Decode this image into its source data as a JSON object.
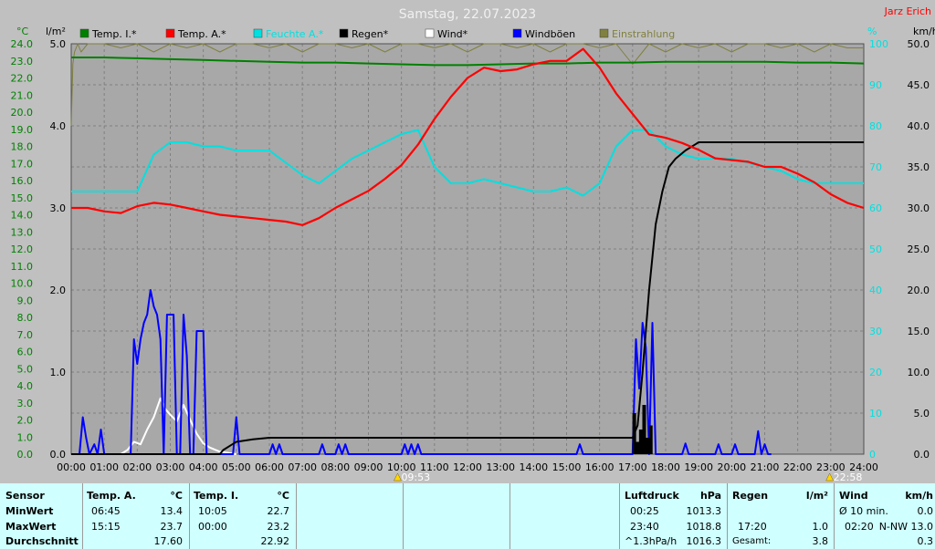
{
  "title": "Samstag, 22.07.2023",
  "station": "Jarz Erich",
  "units": {
    "left1": "°C",
    "left2": "l/m²",
    "right1": "%",
    "right2": "km/h"
  },
  "legend": [
    {
      "label": "Temp. I.*",
      "color": "#008000"
    },
    {
      "label": "Temp. A.*",
      "color": "#ff0000"
    },
    {
      "label": "Feuchte A.*",
      "color": "#00e0e0"
    },
    {
      "label": "Regen*",
      "color": "#000000"
    },
    {
      "label": "Wind*",
      "color": "#ffffff"
    },
    {
      "label": "Windböen",
      "color": "#0000ff"
    },
    {
      "label": "Einstrahlung",
      "color": "#808040"
    }
  ],
  "markers": {
    "sunrise": "09:53",
    "sunset": "22:58"
  },
  "table": {
    "row_labels": {
      "sensor": "Sensor",
      "min": "MinWert",
      "max": "MaxWert",
      "avg": "Durchschnitt"
    },
    "temp_a": {
      "head": "Temp. A.",
      "unit": "°C",
      "min_time": "06:45",
      "min": "13.4",
      "max_time": "15:15",
      "max": "23.7",
      "avg": "17.60"
    },
    "temp_i": {
      "head": "Temp. I.",
      "unit": "°C",
      "min_time": "10:05",
      "min": "22.7",
      "max_time": "00:00",
      "max": "23.2",
      "avg": "22.92"
    },
    "pressure": {
      "head": "Luftdruck",
      "unit": "hPa",
      "min_time": "00:25",
      "min": "1013.3",
      "max_time": "23:40",
      "max": "1018.8",
      "trend": "^1.3hPa/h",
      "avg": "1016.3"
    },
    "rain": {
      "head": "Regen",
      "unit": "l/m²",
      "min_time": "",
      "min": "",
      "max_time": "17:20",
      "max": "1.0",
      "total_label": "Gesamt:",
      "total": "3.8"
    },
    "wind": {
      "head": "Wind",
      "unit": "km/h",
      "min_time": "Ø 10 min.",
      "min": "0.0",
      "max_time": "02:20",
      "max": "N-NW 13.0",
      "avg": "0.3"
    }
  },
  "chart_data": {
    "type": "line",
    "title": "Samstag, 22.07.2023",
    "x_ticks": [
      "00:00",
      "01:00",
      "02:00",
      "03:00",
      "04:00",
      "05:00",
      "06:00",
      "07:00",
      "08:00",
      "09:00",
      "10:00",
      "11:00",
      "12:00",
      "13:00",
      "14:00",
      "15:00",
      "16:00",
      "17:00",
      "18:00",
      "19:00",
      "20:00",
      "21:00",
      "22:00",
      "23:00",
      "24:00"
    ],
    "y_left_temp": {
      "unit": "°C",
      "range": [
        0,
        24
      ],
      "ticks": [
        "0.0",
        "1.0",
        "2.0",
        "3.0",
        "4.0",
        "5.0",
        "6.0",
        "7.0",
        "8.0",
        "9.0",
        "10.0",
        "11.0",
        "12.0",
        "13.0",
        "14.0",
        "15.0",
        "16.0",
        "17.0",
        "18.0",
        "19.0",
        "20.0",
        "21.0",
        "22.0",
        "23.0",
        "24.0"
      ]
    },
    "y_left_rain": {
      "unit": "l/m²",
      "range": [
        0,
        5
      ],
      "ticks": [
        "0.0",
        "1.0",
        "2.0",
        "3.0",
        "4.0",
        "5.0"
      ]
    },
    "y_right_humidity": {
      "unit": "%",
      "range": [
        0,
        100
      ],
      "ticks": [
        "0",
        "10",
        "20",
        "30",
        "40",
        "50",
        "60",
        "70",
        "80",
        "90",
        "100"
      ]
    },
    "y_right_wind": {
      "unit": "km/h",
      "range": [
        0,
        50
      ],
      "ticks": [
        "0.0",
        "5.0",
        "10.0",
        "15.0",
        "20.0",
        "25.0",
        "30.0",
        "35.0",
        "40.0",
        "45.0",
        "50.0"
      ]
    },
    "grid": true,
    "series": [
      {
        "name": "Temp. I.*",
        "axis": "temp",
        "color": "#008000",
        "x": [
          0,
          1,
          2,
          3,
          4,
          5,
          6,
          7,
          8,
          9,
          10,
          11,
          12,
          13,
          14,
          15,
          16,
          17,
          18,
          19,
          20,
          21,
          22,
          23,
          24
        ],
        "y": [
          23.2,
          23.2,
          23.15,
          23.1,
          23.05,
          23.0,
          22.95,
          22.9,
          22.9,
          22.85,
          22.8,
          22.75,
          22.75,
          22.8,
          22.85,
          22.85,
          22.9,
          22.9,
          22.95,
          22.95,
          22.95,
          22.95,
          22.9,
          22.9,
          22.85
        ]
      },
      {
        "name": "Temp. A.*",
        "axis": "temp",
        "color": "#ff0000",
        "x": [
          0,
          0.5,
          1,
          1.5,
          2,
          2.5,
          3,
          3.5,
          4,
          4.5,
          5,
          5.5,
          6,
          6.5,
          7,
          7.5,
          8,
          8.5,
          9,
          9.5,
          10,
          10.5,
          11,
          11.5,
          12,
          12.5,
          13,
          13.5,
          14,
          14.5,
          15,
          15.5,
          16,
          16.5,
          17,
          17.5,
          18,
          18.5,
          19,
          19.5,
          20,
          20.5,
          21,
          21.5,
          22,
          22.5,
          23,
          23.5,
          24
        ],
        "y": [
          14.4,
          14.4,
          14.2,
          14.1,
          14.5,
          14.7,
          14.6,
          14.4,
          14.2,
          14.0,
          13.9,
          13.8,
          13.7,
          13.6,
          13.4,
          13.8,
          14.4,
          14.9,
          15.4,
          16.1,
          16.9,
          18.1,
          19.6,
          20.9,
          22.0,
          22.6,
          22.4,
          22.5,
          22.8,
          23.0,
          23.0,
          23.7,
          22.6,
          21.1,
          19.9,
          18.7,
          18.5,
          18.2,
          17.8,
          17.3,
          17.2,
          17.1,
          16.8,
          16.8,
          16.4,
          15.9,
          15.2,
          14.7,
          14.4
        ]
      },
      {
        "name": "Feuchte A.*",
        "axis": "humidity",
        "color": "#00e0e0",
        "x": [
          0,
          0.5,
          1,
          1.5,
          2,
          2.5,
          3,
          3.5,
          4,
          4.5,
          5,
          5.5,
          6,
          6.5,
          7,
          7.5,
          8,
          8.5,
          9,
          9.5,
          10,
          10.5,
          11,
          11.5,
          12,
          12.5,
          13,
          13.5,
          14,
          14.5,
          15,
          15.5,
          16,
          16.5,
          17,
          17.5,
          18,
          18.5,
          19,
          19.5,
          20,
          20.5,
          21,
          21.5,
          22,
          22.5,
          23,
          23.5,
          24
        ],
        "y": [
          64,
          64,
          64,
          64,
          64,
          73,
          76,
          76,
          75,
          75,
          74,
          74,
          74,
          71,
          68,
          66,
          69,
          72,
          74,
          76,
          78,
          79,
          70,
          66,
          66,
          67,
          66,
          65,
          64,
          64,
          65,
          63,
          66,
          75,
          79,
          79,
          75,
          73,
          72,
          72,
          72,
          71,
          70,
          69,
          67,
          66,
          66,
          66,
          66
        ]
      },
      {
        "name": "Regen*",
        "axis": "rain",
        "color": "#000000",
        "x": [
          0,
          4.5,
          4.6,
          5,
          5.5,
          6,
          10,
          15,
          17,
          17.15,
          17.3,
          17.5,
          17.7,
          17.9,
          18.1,
          18.3,
          18.6,
          19,
          19.5,
          20,
          21,
          22,
          23,
          24
        ],
        "y": [
          0,
          0,
          0.05,
          0.15,
          0.18,
          0.2,
          0.2,
          0.2,
          0.2,
          0.35,
          1.0,
          2.0,
          2.8,
          3.2,
          3.5,
          3.6,
          3.7,
          3.8,
          3.8,
          3.8,
          3.8,
          3.8,
          3.8,
          3.8
        ]
      },
      {
        "name": "Wind*",
        "axis": "wind",
        "color": "#ffffff",
        "x": [
          0,
          1.5,
          1.7,
          1.9,
          2.1,
          2.3,
          2.5,
          2.7,
          2.85,
          3.0,
          3.2,
          3.4,
          3.6,
          3.8,
          4.0,
          4.2,
          4.5,
          5
        ],
        "y": [
          0,
          0,
          0.5,
          1.5,
          1.2,
          3.0,
          4.5,
          6.8,
          5.5,
          4.8,
          4.0,
          6.0,
          4.2,
          2.5,
          1.3,
          0.8,
          0.3,
          0
        ]
      },
      {
        "name": "Windböen",
        "axis": "wind",
        "color": "#0000ff",
        "x": [
          0,
          0.25,
          0.35,
          0.45,
          0.55,
          0.7,
          0.8,
          0.9,
          1.0,
          1.8,
          1.9,
          2.0,
          2.1,
          2.2,
          2.3,
          2.4,
          2.5,
          2.6,
          2.7,
          2.8,
          2.9,
          3.0,
          3.1,
          3.2,
          3.3,
          3.4,
          3.5,
          3.6,
          3.7,
          3.8,
          3.9,
          4.0,
          4.1,
          4.2,
          4.3,
          4.4,
          4.5,
          4.9,
          5.0,
          5.1,
          5.2,
          6.0,
          6.1,
          6.2,
          6.3,
          6.4,
          6.5,
          7.5,
          7.6,
          7.7,
          7.8,
          8.0,
          8.1,
          8.2,
          8.3,
          8.4,
          10.0,
          10.1,
          10.2,
          10.3,
          10.4,
          10.5,
          10.6,
          10.7,
          15.3,
          15.4,
          15.5,
          17.0,
          17.1,
          17.2,
          17.3,
          17.4,
          17.5,
          17.6,
          17.7,
          17.8,
          17.9,
          18.0,
          18.1,
          18.2,
          18.5,
          18.6,
          18.7,
          19.5,
          19.6,
          19.7,
          20.0,
          20.1,
          20.2,
          20.7,
          20.8,
          20.9,
          21.0,
          21.1,
          21.2
        ],
        "y": [
          0,
          0,
          4.5,
          2,
          0,
          1.2,
          0,
          3,
          0,
          0,
          14,
          11,
          14,
          16,
          17,
          20,
          18,
          17,
          14,
          0,
          17,
          17,
          17,
          0,
          0,
          17,
          12,
          0,
          0,
          15,
          15,
          15,
          0,
          0,
          0,
          0,
          0,
          0,
          4.5,
          0,
          0,
          0,
          1.2,
          0,
          1.2,
          0,
          0,
          0,
          1.2,
          0,
          0,
          0,
          1.2,
          0,
          1.2,
          0,
          0,
          1.2,
          0,
          1.2,
          0,
          1.2,
          0,
          0,
          0,
          1.2,
          0,
          0,
          14,
          8,
          16,
          13,
          0,
          16,
          0,
          0,
          0,
          0,
          0,
          0,
          0,
          1.3,
          0,
          0,
          1.2,
          0,
          0,
          1.2,
          0,
          0,
          2.8,
          0,
          1.2,
          0,
          0
        ]
      },
      {
        "name": "Einstrahlung",
        "axis": "humidity",
        "color": "#808040",
        "x": [
          0,
          0.05,
          0.1,
          0.2,
          0.3,
          0.5,
          1,
          1.5,
          2,
          2.5,
          3,
          3.5,
          4,
          4.5,
          5,
          5.5,
          6,
          6.5,
          7,
          7.5,
          8,
          8.5,
          9,
          9.5,
          10,
          10.5,
          11,
          11.5,
          12,
          12.5,
          13,
          13.5,
          14,
          14.5,
          15,
          15.5,
          16,
          16.5,
          17,
          17.5,
          18,
          18.5,
          19,
          19.5,
          20,
          20.5,
          21,
          21.5,
          22,
          22.5,
          23,
          23.5,
          24
        ],
        "y": [
          80,
          95,
          98,
          100,
          98,
          100,
          100,
          99,
          100,
          98,
          100,
          99,
          100,
          98,
          100,
          100,
          99,
          100,
          98,
          100,
          100,
          99,
          100,
          98,
          100,
          100,
          99,
          100,
          98,
          100,
          100,
          99,
          100,
          98,
          100,
          100,
          99,
          100,
          95,
          100,
          98,
          100,
          99,
          100,
          98,
          100,
          100,
          99,
          100,
          98,
          100,
          99,
          99
        ]
      }
    ]
  }
}
